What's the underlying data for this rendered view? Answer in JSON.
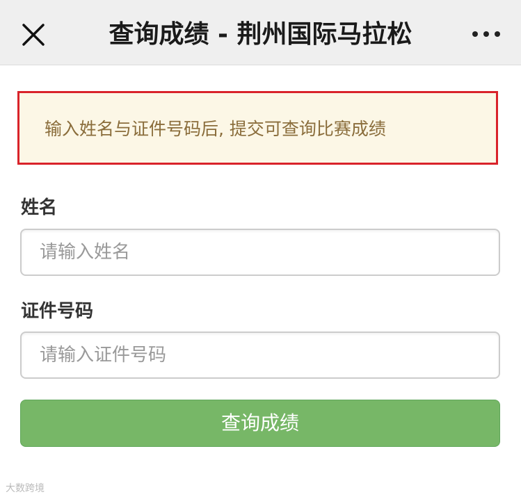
{
  "header": {
    "title": "查询成绩 - 荆州国际马拉松",
    "close_icon": "close-icon",
    "more_icon": "more-icon"
  },
  "notice": {
    "text": "输入姓名与证件号码后, 提交可查询比赛成绩",
    "border_color": "#d9232a",
    "background_color": "#fcf7e6"
  },
  "form": {
    "name_label": "姓名",
    "name_placeholder": "请输入姓名",
    "id_label": "证件号码",
    "id_placeholder": "请输入证件号码",
    "submit_label": "查询成绩",
    "submit_color": "#77b767"
  },
  "watermark": {
    "text": "大数跨境"
  }
}
